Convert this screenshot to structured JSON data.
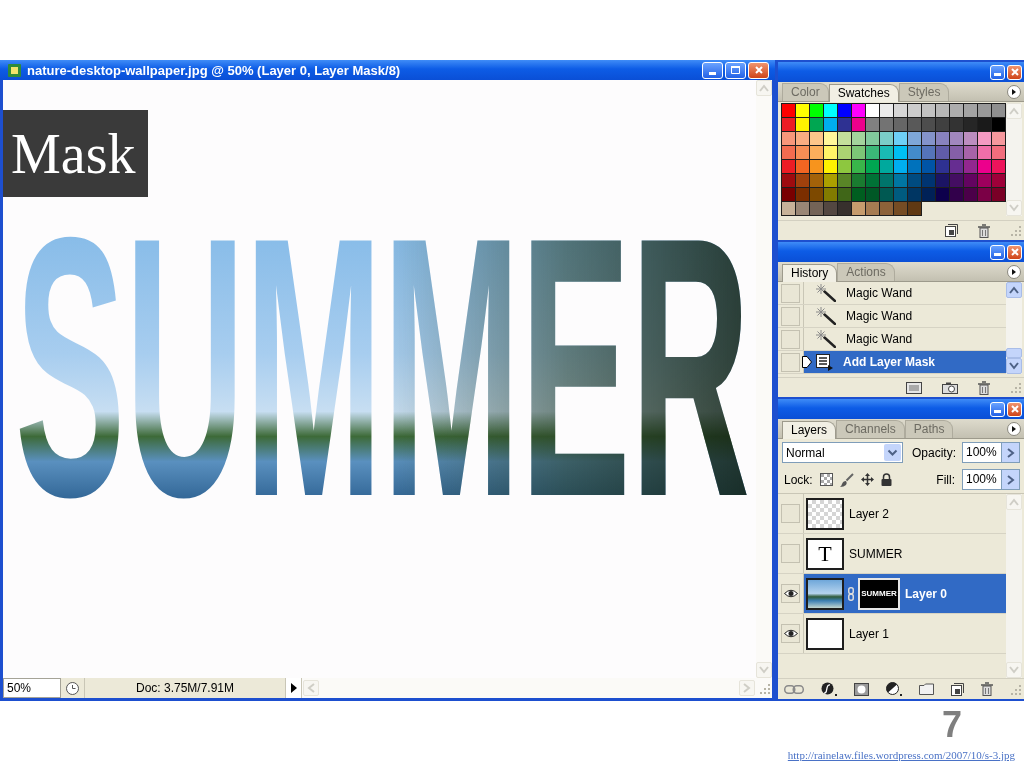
{
  "document": {
    "title": "nature-desktop-wallpaper.jpg @ 50% (Layer 0, Layer Mask/8)",
    "canvas_text": "SUMMER",
    "zoom": "50%",
    "doc_info": "Doc: 3.75M/7.91M"
  },
  "caption": {
    "label": "Mask"
  },
  "swatches_panel": {
    "tabs": [
      {
        "label": "Color",
        "selected": false
      },
      {
        "label": "Swatches",
        "selected": true
      },
      {
        "label": "Styles",
        "selected": false
      }
    ],
    "swatches": [
      {
        "color": "#ff0000"
      },
      {
        "color": "#ffff00"
      },
      {
        "color": "#00ff00"
      },
      {
        "color": "#00ffff"
      },
      {
        "color": "#0000ff"
      },
      {
        "color": "#ff00ff"
      },
      {
        "color": "#ffffff"
      },
      {
        "color": "#ebebeb"
      },
      {
        "color": "#d6d6d6"
      },
      {
        "color": "#cccccc"
      },
      {
        "color": "#c2c2c2"
      },
      {
        "color": "#b7b7b7"
      },
      {
        "color": "#adadad"
      },
      {
        "color": "#a3a3a3"
      },
      {
        "color": "#999999"
      },
      {
        "color": "#8f8f8f"
      },
      {
        "color": "#ed1c24"
      },
      {
        "color": "#fff200"
      },
      {
        "color": "#00a651"
      },
      {
        "color": "#00aeef"
      },
      {
        "color": "#2e3192"
      },
      {
        "color": "#ec008c"
      },
      {
        "color": "#808080"
      },
      {
        "color": "#737373"
      },
      {
        "color": "#666666"
      },
      {
        "color": "#595959"
      },
      {
        "color": "#4d4d4d"
      },
      {
        "color": "#404040"
      },
      {
        "color": "#333333"
      },
      {
        "color": "#262626"
      },
      {
        "color": "#1a1a1a"
      },
      {
        "color": "#000000"
      },
      {
        "color": "#f7977a"
      },
      {
        "color": "#f9ad81"
      },
      {
        "color": "#fdc68a"
      },
      {
        "color": "#fff79a"
      },
      {
        "color": "#c4df9b"
      },
      {
        "color": "#a3d39c"
      },
      {
        "color": "#82ca9d"
      },
      {
        "color": "#7bcdc8"
      },
      {
        "color": "#6ecff6"
      },
      {
        "color": "#7ea7d8"
      },
      {
        "color": "#8493ca"
      },
      {
        "color": "#8882be"
      },
      {
        "color": "#a187be"
      },
      {
        "color": "#bc8dbf"
      },
      {
        "color": "#f49ac2"
      },
      {
        "color": "#f6989d"
      },
      {
        "color": "#f26c4f"
      },
      {
        "color": "#f68e55"
      },
      {
        "color": "#fbaf5c"
      },
      {
        "color": "#fff467"
      },
      {
        "color": "#acd372"
      },
      {
        "color": "#7cc576"
      },
      {
        "color": "#3bb878"
      },
      {
        "color": "#1abbb4"
      },
      {
        "color": "#00bff3"
      },
      {
        "color": "#438ccb"
      },
      {
        "color": "#5574b9"
      },
      {
        "color": "#605ca8"
      },
      {
        "color": "#855fa8"
      },
      {
        "color": "#a763a8"
      },
      {
        "color": "#f06ea9"
      },
      {
        "color": "#f26d7d"
      },
      {
        "color": "#ed1c24"
      },
      {
        "color": "#f26522"
      },
      {
        "color": "#f7941d"
      },
      {
        "color": "#fff200"
      },
      {
        "color": "#8dc73f"
      },
      {
        "color": "#39b54a"
      },
      {
        "color": "#00a651"
      },
      {
        "color": "#00a99d"
      },
      {
        "color": "#00aeef"
      },
      {
        "color": "#0072bc"
      },
      {
        "color": "#0054a6"
      },
      {
        "color": "#2e3192"
      },
      {
        "color": "#662d91"
      },
      {
        "color": "#92278f"
      },
      {
        "color": "#ec008c"
      },
      {
        "color": "#ed145b"
      },
      {
        "color": "#9e0b0f"
      },
      {
        "color": "#a0410d"
      },
      {
        "color": "#a36209"
      },
      {
        "color": "#aba000"
      },
      {
        "color": "#598527"
      },
      {
        "color": "#1a7b30"
      },
      {
        "color": "#007236"
      },
      {
        "color": "#00746b"
      },
      {
        "color": "#0076a3"
      },
      {
        "color": "#004b80"
      },
      {
        "color": "#003471"
      },
      {
        "color": "#1b1464"
      },
      {
        "color": "#440e62"
      },
      {
        "color": "#630460"
      },
      {
        "color": "#9e005d"
      },
      {
        "color": "#9e0039"
      },
      {
        "color": "#790000"
      },
      {
        "color": "#7b2e00"
      },
      {
        "color": "#7d4900"
      },
      {
        "color": "#827b00"
      },
      {
        "color": "#406618"
      },
      {
        "color": "#005e20"
      },
      {
        "color": "#005826"
      },
      {
        "color": "#005952"
      },
      {
        "color": "#005b7f"
      },
      {
        "color": "#003663"
      },
      {
        "color": "#002157"
      },
      {
        "color": "#0d004c"
      },
      {
        "color": "#32004b"
      },
      {
        "color": "#4b0049"
      },
      {
        "color": "#7b0046"
      },
      {
        "color": "#7a0026"
      },
      {
        "color": "#c7b299"
      },
      {
        "color": "#998675"
      },
      {
        "color": "#736357"
      },
      {
        "color": "#534741"
      },
      {
        "color": "#37302d"
      },
      {
        "color": "#c69c6d"
      },
      {
        "color": "#a67c52"
      },
      {
        "color": "#8c6239"
      },
      {
        "color": "#754c24"
      },
      {
        "color": "#603913"
      }
    ]
  },
  "history_panel": {
    "tabs": [
      {
        "label": "History",
        "selected": true
      },
      {
        "label": "Actions",
        "selected": false
      }
    ],
    "states": [
      {
        "label": "Magic Wand",
        "kind": "wand",
        "selected": false
      },
      {
        "label": "Magic Wand",
        "kind": "wand",
        "selected": false
      },
      {
        "label": "Magic Wand",
        "kind": "wand",
        "selected": false
      },
      {
        "label": "Add Layer Mask",
        "kind": "mask",
        "selected": true
      }
    ]
  },
  "layers_panel": {
    "tabs": [
      {
        "label": "Layers",
        "selected": true
      },
      {
        "label": "Channels",
        "selected": false
      },
      {
        "label": "Paths",
        "selected": false
      }
    ],
    "blend_mode": "Normal",
    "opacity_label": "Opacity:",
    "opacity": "100%",
    "lock_label": "Lock:",
    "fill_label": "Fill:",
    "fill": "100%",
    "layers": [
      {
        "name": "Layer 2",
        "kind": "transparent",
        "visible": false,
        "selected": false
      },
      {
        "name": "SUMMER",
        "kind": "text",
        "thumb_text": "T",
        "visible": false,
        "selected": false
      },
      {
        "name": "Layer 0",
        "kind": "masked",
        "mask_text": "SUMMER",
        "visible": true,
        "selected": true
      },
      {
        "name": "Layer 1",
        "kind": "fill",
        "visible": true,
        "selected": false
      }
    ]
  },
  "slide": {
    "number": "7",
    "source_url": "http://rainelaw.files.wordpress.com/2007/10/s-3.jpg"
  }
}
